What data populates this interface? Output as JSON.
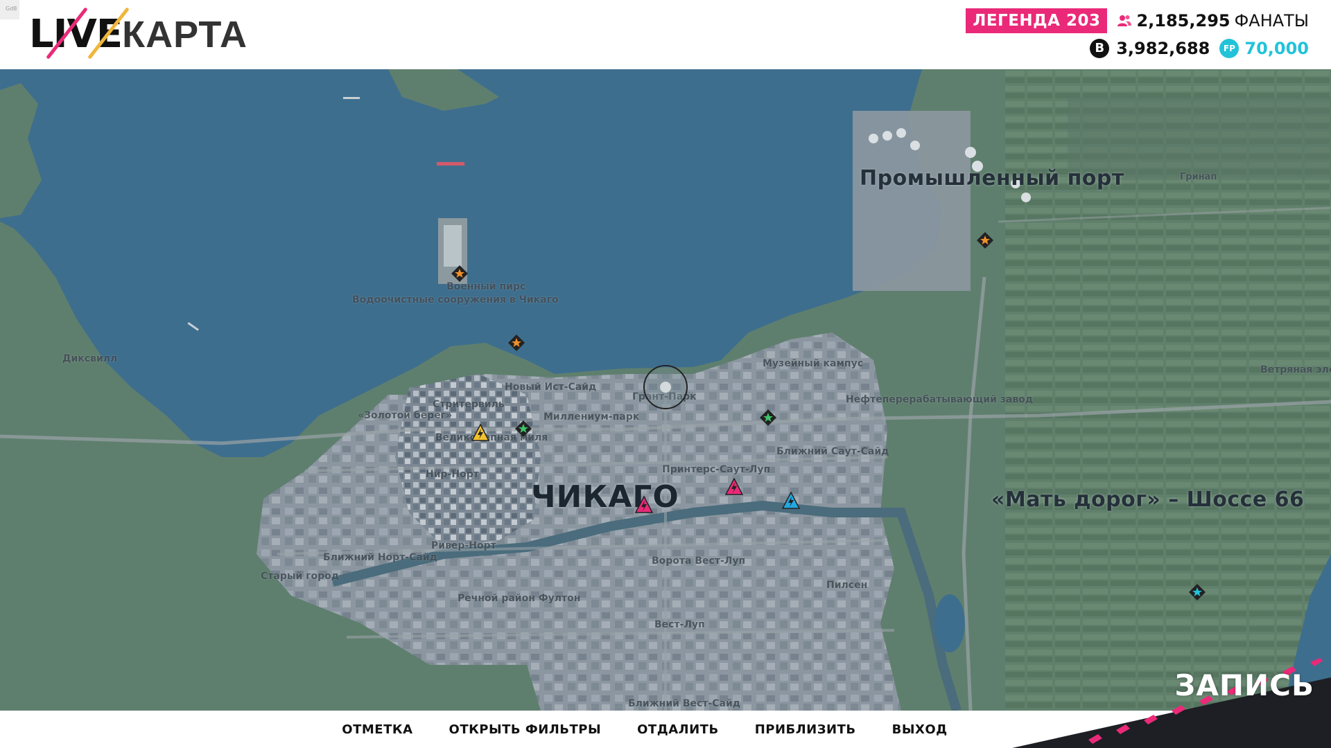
{
  "corner_tag": "Gd8",
  "logo": {
    "live": "LIVE",
    "map": "КАРТА",
    "slash_color_1": "#ea2a78",
    "slash_color_2": "#f0b63a"
  },
  "header": {
    "level_badge": "ЛЕГЕНДА 203",
    "fans_value": "2,185,295",
    "fans_label": "ФАНАТЫ",
    "fans_icon": "people-icon",
    "credits_icon_glyph": "B",
    "credits": "3,982,688",
    "forzathon_icon_glyph": "FP",
    "forzathon_points": "70,000",
    "colors": {
      "badge": "#ea2a78",
      "fp": "#22c3d9"
    }
  },
  "map": {
    "labels": {
      "industrial_port": "Промышленный порт",
      "greenup": "Гринап",
      "military_pier": "Военный пирс",
      "water_treatment": "Водоочистные сооружения в Чикаго",
      "dixville": "Диксвилл",
      "new_east_side": "Новый Ист-Сайд",
      "grant_park": "Грант-Парк",
      "museum_campus": "Музейный кампус",
      "refinery": "Нефтеперерабатывающий завод",
      "wind_farm": "Ветряная эле",
      "streeterville": "Стритервиль",
      "gold_coast": "«Золотой берег»",
      "millennium_park": "Миллениум-парк",
      "magnificent_mile": "Великолепная миля",
      "near_south_side": "Ближний Саут-Сайд",
      "printers_south_loop": "Принтерс-Саут-Луп",
      "near_north": "Нир-Норт",
      "chicago": "ЧИКАГО",
      "route66": "«Мать дорог» – Шоссе 66",
      "river_north": "Ривер-Норт",
      "near_north_side": "Ближний Норт-Сайд",
      "west_loop_gate": "Ворота Вест-Луп",
      "old_town": "Старый город",
      "pilsen": "Пилсен",
      "fulton_river": "Речной район Фултон",
      "west_loop": "Вест-Луп",
      "near_west_side": "Ближний Вест-Сайд"
    },
    "colors": {
      "water": "#3e6e8e",
      "land": "#5f7f6e",
      "city": "#8a94a0",
      "road": "#9aa2a6"
    }
  },
  "bottom_bar": {
    "mark": "ОТМЕТКА",
    "filters": "ОТКРЫТЬ ФИЛЬТРЫ",
    "zoom_out": "ОТДАЛИТЬ",
    "zoom_in": "ПРИБЛИЗИТЬ",
    "exit": "ВЫХОД"
  },
  "recording": {
    "label": "ЗАПИСЬ",
    "color": "#ea2a78"
  }
}
